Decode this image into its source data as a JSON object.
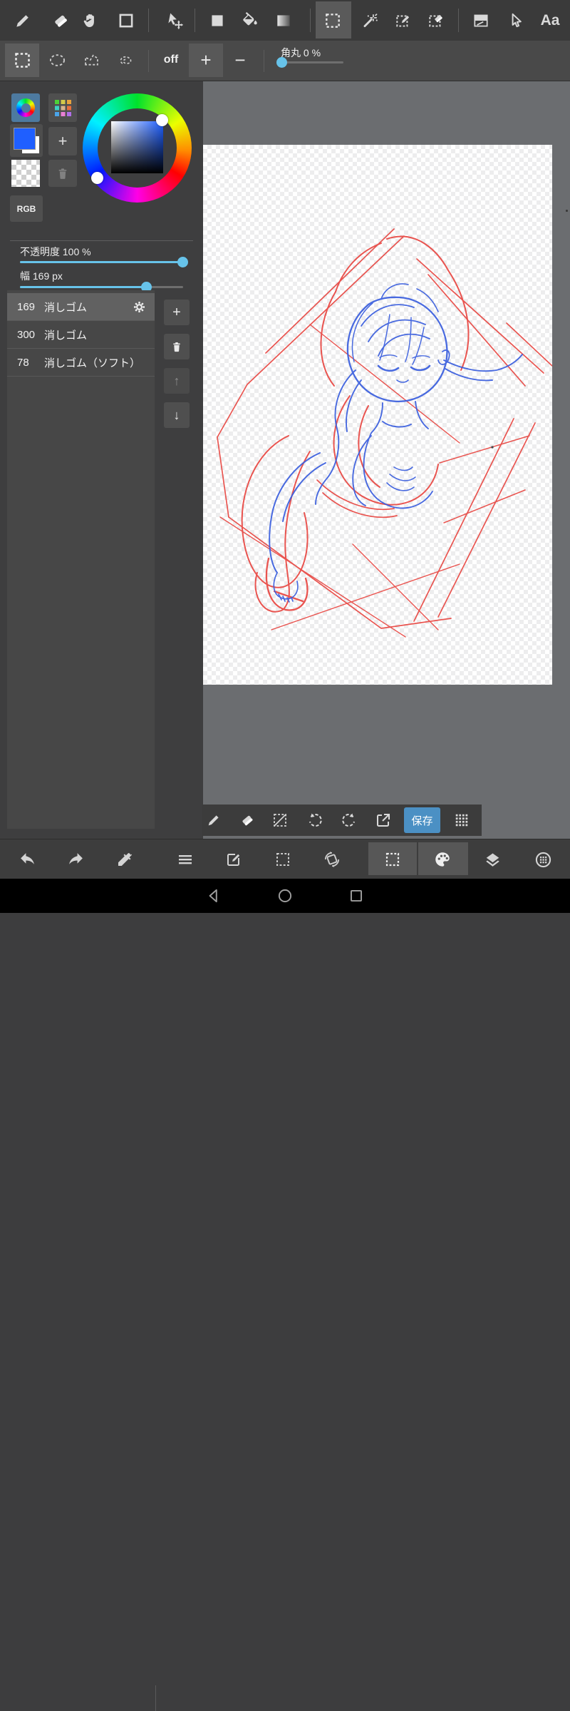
{
  "top_toolbar": {
    "text_tool_label": "Aa"
  },
  "select_toolbar": {
    "mode_off": "off",
    "size_plus": "+",
    "size_minus": "−",
    "corner_radius": {
      "label": "角丸",
      "value": "0",
      "unit": "%"
    }
  },
  "color_panel": {
    "rgb_label": "RGB"
  },
  "brush_settings": {
    "opacity": {
      "label": "不透明度",
      "value": "100",
      "unit": "%"
    },
    "width": {
      "label": "幅",
      "value": "169",
      "unit": "px"
    }
  },
  "brush_list": {
    "items": [
      {
        "size": "169",
        "name": "消しゴム"
      },
      {
        "size": "300",
        "name": "消しゴム"
      },
      {
        "size": "78",
        "name": "消しゴム（ソフト）"
      }
    ],
    "controls": {
      "add": "+",
      "move_up": "↑",
      "move_down": "↓"
    }
  },
  "canvas_toolbar": {
    "save_label": "保存"
  },
  "colors": {
    "accent": "#67c3ea",
    "current_color": "#1f5fff",
    "save_button": "#4b90c4",
    "sketch_red": "#e8433e",
    "sketch_blue": "#3a5ede"
  }
}
